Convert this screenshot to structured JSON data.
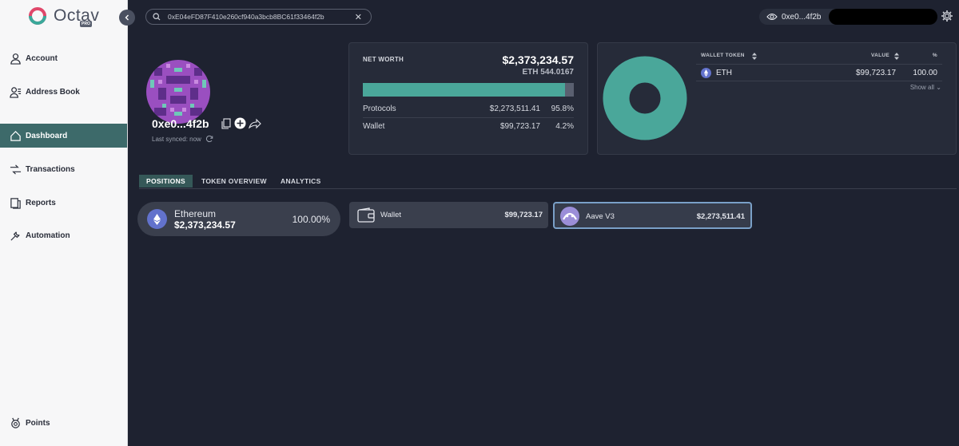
{
  "app": {
    "name": "Octav",
    "badge": "PRO"
  },
  "sidebar": {
    "items": [
      {
        "label": "Account",
        "icon": "user-icon"
      },
      {
        "label": "Address Book",
        "icon": "contacts-icon"
      },
      {
        "label": "Dashboard",
        "icon": "home-icon",
        "active": true
      },
      {
        "label": "Transactions",
        "icon": "transfer-icon"
      },
      {
        "label": "Reports",
        "icon": "report-icon"
      },
      {
        "label": "Automation",
        "icon": "wrench-icon"
      },
      {
        "label": "Points",
        "icon": "points-icon"
      }
    ]
  },
  "search": {
    "value": "0xE04eFD87F410e260cf940a3bcb8BC61f33464f2b"
  },
  "header": {
    "wallet_short": "0xe0...4f2b"
  },
  "profile": {
    "address": "0xe0...4f2b",
    "synced": "Last synced: now"
  },
  "net_worth": {
    "label": "NET WORTH",
    "value": "$2,373,234.57",
    "eth": "ETH 544.0167",
    "bar_fraction": 0.958,
    "rows": [
      {
        "name": "Protocols",
        "value": "$2,273,511.41",
        "pct": "95.8%"
      },
      {
        "name": "Wallet",
        "value": "$99,723.17",
        "pct": "4.2%"
      }
    ]
  },
  "wallet_tokens": {
    "headers": {
      "token": "WALLET TOKEN",
      "value": "VALUE",
      "pct": "%"
    },
    "rows": [
      {
        "token": "ETH",
        "value": "$99,723.17",
        "pct": "100.00"
      }
    ],
    "show_all": "Show all",
    "donut_color": "#4aa79a"
  },
  "tabs": [
    "POSITIONS",
    "TOKEN OVERVIEW",
    "ANALYTICS"
  ],
  "positions": {
    "chain": {
      "name": "Ethereum",
      "amount": "$2,373,234.57",
      "pct": "100.00%"
    },
    "tiles": [
      {
        "name": "Wallet",
        "value": "$99,723.17"
      },
      {
        "name": "Aave V3",
        "value": "$2,273,511.41"
      }
    ]
  },
  "colors": {
    "accent": "#4aa79a",
    "active_nav": "#3d6a6a",
    "background": "#1e2230"
  }
}
